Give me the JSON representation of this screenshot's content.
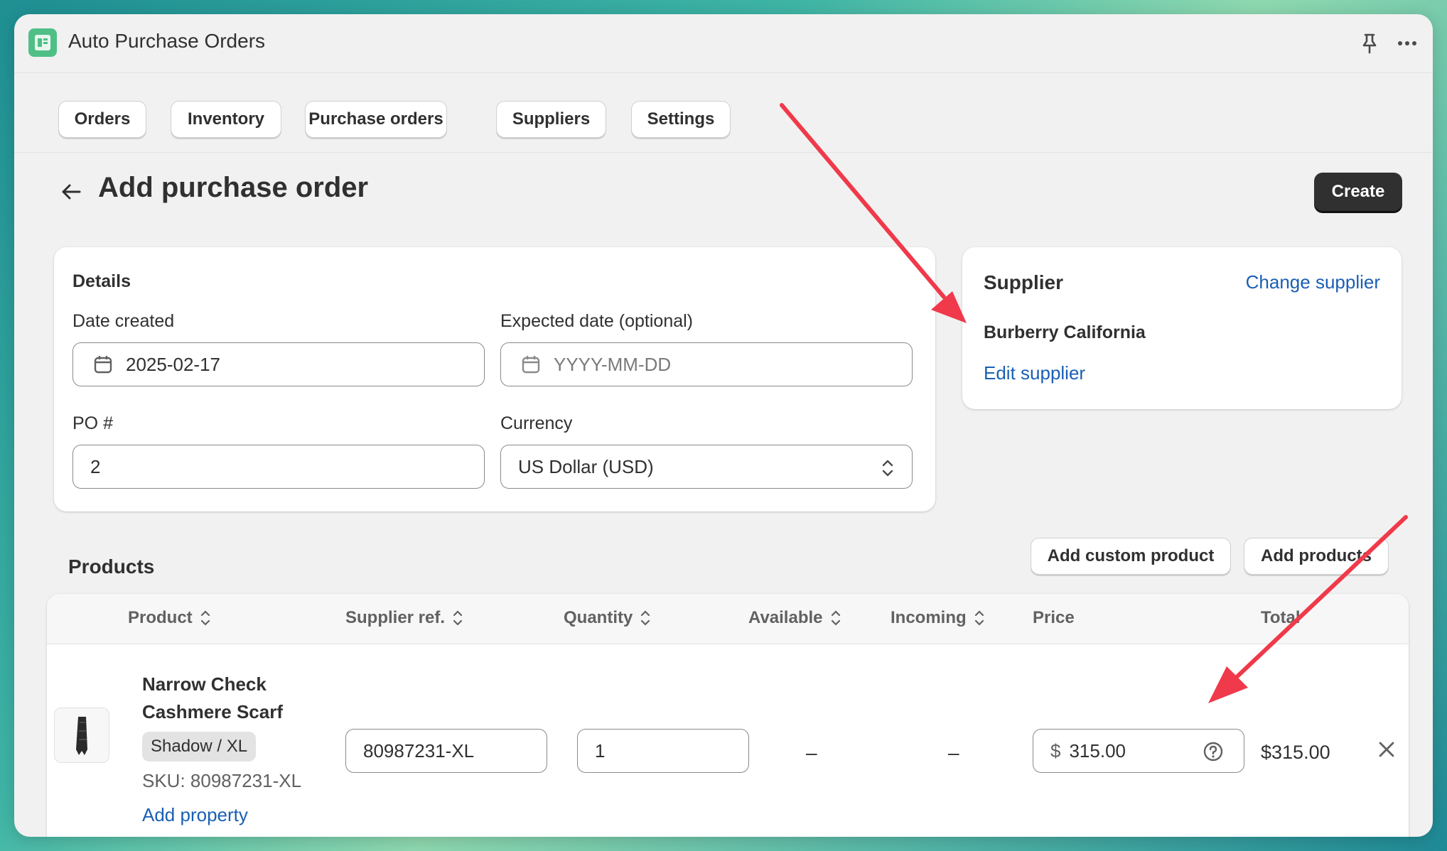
{
  "app": {
    "title": "Auto Purchase Orders"
  },
  "nav": {
    "tabs": [
      "Orders",
      "Inventory",
      "Purchase orders",
      "Suppliers",
      "Settings"
    ]
  },
  "page": {
    "title": "Add purchase order",
    "create_label": "Create"
  },
  "details": {
    "heading": "Details",
    "date_created_label": "Date created",
    "date_created_value": "2025-02-17",
    "expected_date_label": "Expected date (optional)",
    "expected_date_placeholder": "YYYY-MM-DD",
    "po_label": "PO #",
    "po_value": "2",
    "currency_label": "Currency",
    "currency_value": "US Dollar (USD)"
  },
  "supplier": {
    "heading": "Supplier",
    "change_label": "Change supplier",
    "name": "Burberry California",
    "edit_label": "Edit supplier"
  },
  "products": {
    "heading": "Products",
    "add_custom_label": "Add custom product",
    "add_products_label": "Add products",
    "columns": [
      "Product",
      "Supplier ref.",
      "Quantity",
      "Available",
      "Incoming",
      "Price",
      "Total"
    ],
    "rows": [
      {
        "name": "Narrow Check Cashmere Scarf",
        "variant": "Shadow / XL",
        "sku": "SKU: 80987231-XL",
        "add_property_label": "Add property",
        "supplier_ref": "80987231-XL",
        "quantity": "1",
        "available": "–",
        "incoming": "–",
        "currency_symbol": "$",
        "price": "315.00",
        "total": "$315.00"
      }
    ]
  },
  "colors": {
    "primary_button": "#303030",
    "link": "#1a5fb4",
    "annotation_arrow": "#f0394a",
    "app_icon": "#4fbf86"
  }
}
